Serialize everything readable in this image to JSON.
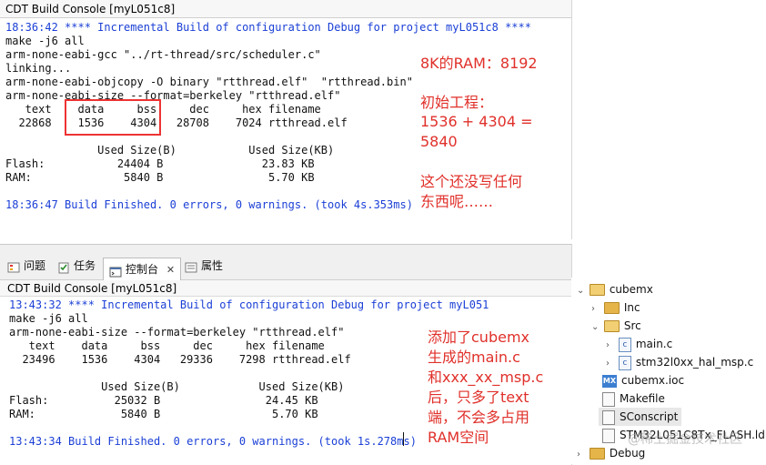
{
  "top_console": {
    "title": "CDT Build Console [myL051c8]",
    "lines": [
      {
        "text": "18:36:42 **** Incremental Build of configuration Debug for project myL051c8 ****",
        "color": "blue"
      },
      {
        "text": "make -j6 all",
        "color": "black"
      },
      {
        "text": "arm-none-eabi-gcc \"../rt-thread/src/scheduler.c\"",
        "color": "black"
      },
      {
        "text": "linking...",
        "color": "black"
      },
      {
        "text": "arm-none-eabi-objcopy -O binary \"rtthread.elf\"  \"rtthread.bin\"",
        "color": "black"
      },
      {
        "text": "arm-none-eabi-size --format=berkeley \"rtthread.elf\"",
        "color": "black"
      },
      {
        "text": "   text    data     bss     dec     hex filename",
        "color": "black"
      },
      {
        "text": "  22868    1536    4304   28708    7024 rtthread.elf",
        "color": "black"
      },
      {
        "text": "",
        "color": "black"
      },
      {
        "text": "              Used Size(B)           Used Size(KB)",
        "color": "black"
      },
      {
        "text": "Flash:           24404 B               23.83 KB",
        "color": "black"
      },
      {
        "text": "RAM:              5840 B                5.70 KB",
        "color": "black"
      },
      {
        "text": "",
        "color": "black"
      },
      {
        "text": "18:36:47 Build Finished. 0 errors, 0 warnings. (took 4s.353ms)",
        "color": "blue"
      }
    ]
  },
  "annotations_top": [
    "8K的RAM：8192",
    "初始工程：",
    "1536 + 4304 =",
    "5840",
    "这个还没写任何",
    "东西呢……"
  ],
  "tabs": [
    {
      "label": "问题",
      "icon": "problems-icon"
    },
    {
      "label": "任务",
      "icon": "tasks-icon"
    },
    {
      "label": "控制台",
      "icon": "console-icon",
      "close": "✕"
    },
    {
      "label": "属性",
      "icon": "properties-icon"
    }
  ],
  "bottom_console": {
    "title": "CDT Build Console [myL051c8]",
    "lines": [
      {
        "text": "13:43:32 **** Incremental Build of configuration Debug for project myL051",
        "color": "blue"
      },
      {
        "text": "make -j6 all",
        "color": "black"
      },
      {
        "text": "arm-none-eabi-size --format=berkeley \"rtthread.elf\"",
        "color": "black"
      },
      {
        "text": "   text    data     bss     dec     hex filename",
        "color": "black"
      },
      {
        "text": "  23496    1536    4304   29336    7298 rtthread.elf",
        "color": "black"
      },
      {
        "text": "",
        "color": "black"
      },
      {
        "text": "              Used Size(B)            Used Size(KB)",
        "color": "black"
      },
      {
        "text": "Flash:          25032 B                24.45 KB",
        "color": "black"
      },
      {
        "text": "RAM:             5840 B                 5.70 KB",
        "color": "black"
      },
      {
        "text": "",
        "color": "black"
      },
      {
        "text": "13:43:34 Build Finished. 0 errors, 0 warnings. (took 1s.278ms)",
        "color": "blue"
      }
    ]
  },
  "annotations_bottom": [
    "添加了cubemx",
    "生成的main.c",
    "和xxx_xx_msp.c",
    "后，只多了text",
    "端，不会多占用",
    "RAM空间"
  ],
  "tree": {
    "items": [
      {
        "label": "cubemx",
        "kind": "folder",
        "expanded": true,
        "chevron": "⌄"
      },
      {
        "label": "Inc",
        "kind": "folder",
        "expanded": false,
        "chevron": "›"
      },
      {
        "label": "Src",
        "kind": "folder",
        "expanded": true,
        "chevron": "⌄"
      },
      {
        "label": "main.c",
        "kind": "c-file",
        "chevron": "›"
      },
      {
        "label": "stm32l0xx_hal_msp.c",
        "kind": "c-file",
        "chevron": "›"
      },
      {
        "label": "cubemx.ioc",
        "kind": "mx-file"
      },
      {
        "label": "Makefile",
        "kind": "file"
      },
      {
        "label": "SConscript",
        "kind": "file",
        "selected": true
      },
      {
        "label": "STM32L051C8Tx_FLASH.ld",
        "kind": "file"
      },
      {
        "label": "Debug",
        "kind": "folder",
        "expanded": false,
        "chevron": "›"
      }
    ]
  },
  "watermark": "@稀土掘金技术社区"
}
